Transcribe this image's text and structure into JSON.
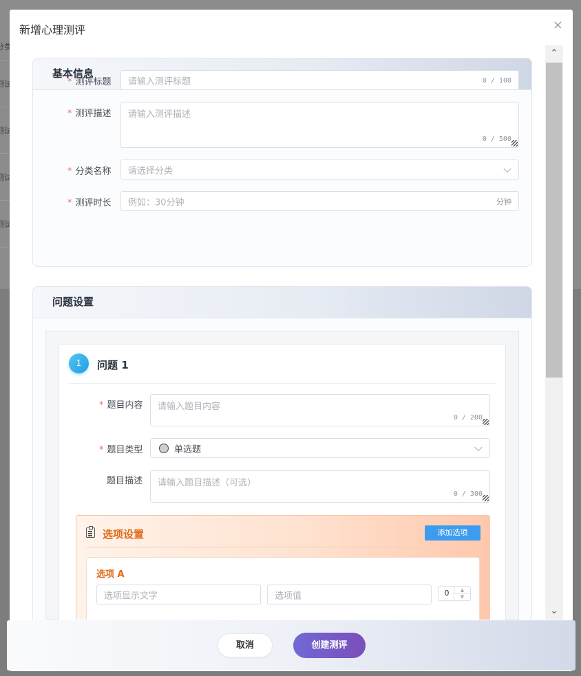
{
  "background": {
    "rows": [
      "分类",
      "测试",
      "测试",
      "测试",
      "测试"
    ]
  },
  "dialog": {
    "title": "新增心理测评",
    "close_icon": "×"
  },
  "basic_info": {
    "heading": "基本信息",
    "required_mark": "*",
    "title_field": {
      "label": "测评标题",
      "placeholder": "请输入测评标题",
      "counter": "0 / 100"
    },
    "desc_field": {
      "label": "测评描述",
      "placeholder": "请输入测评描述",
      "counter": "0 / 500"
    },
    "category_field": {
      "label": "分类名称",
      "placeholder": "请选择分类"
    },
    "duration_field": {
      "label": "测评时长",
      "placeholder": "例如：30分钟",
      "suffix": "分钟"
    }
  },
  "question_settings": {
    "heading": "问题设置",
    "question": {
      "number": "1",
      "title": "问题 1",
      "content_field": {
        "label": "题目内容",
        "placeholder": "请输入题目内容",
        "counter": "0 / 200"
      },
      "type_field": {
        "label": "题目类型",
        "value": "单选题"
      },
      "desc_field": {
        "label": "题目描述",
        "placeholder": "请输入题目描述（可选）",
        "counter": "0 / 300"
      },
      "options": {
        "heading": "选项设置",
        "add_button": "添加选项",
        "items": [
          {
            "label": "选项 A",
            "text_placeholder": "选项显示文字",
            "value_placeholder": "选项值",
            "score": "0"
          }
        ]
      }
    }
  },
  "scrollbar": {
    "up_icon": "⌃",
    "down_icon": "⌄"
  },
  "footer": {
    "cancel_label": "取消",
    "create_label": "创建测评"
  }
}
